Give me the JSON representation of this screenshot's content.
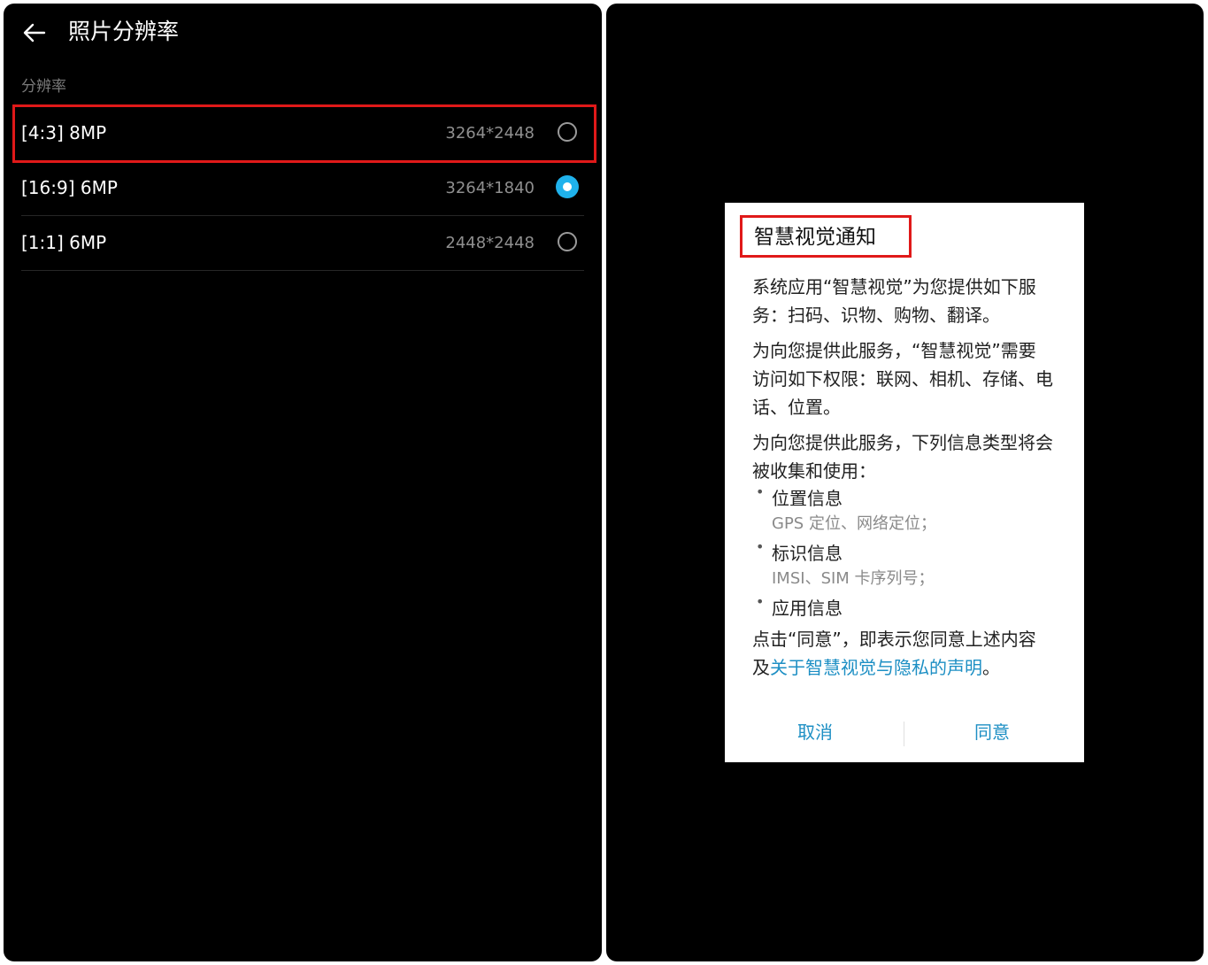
{
  "left_screen": {
    "title": "照片分辨率",
    "section_label": "分辨率",
    "options": [
      {
        "label": "[4:3] 8MP",
        "size": "3264*2448",
        "selected": false,
        "highlighted": true
      },
      {
        "label": "[16:9] 6MP",
        "size": "3264*1840",
        "selected": true,
        "highlighted": false
      },
      {
        "label": "[1:1] 6MP",
        "size": "2448*2448",
        "selected": false,
        "highlighted": false
      }
    ]
  },
  "dialog": {
    "title": "智慧视觉通知",
    "para1": "系统应用“智慧视觉”为您提供如下服务：扫码、识物、购物、翻译。",
    "para2": "为向您提供此服务，“智慧视觉”需要访问如下权限：联网、相机、存储、电话、位置。",
    "para3": "为向您提供此服务，下列信息类型将会被收集和使用：",
    "bullets": [
      {
        "title": "位置信息",
        "detail": "GPS 定位、网络定位；"
      },
      {
        "title": "标识信息",
        "detail": "IMSI、SIM 卡序列号；"
      },
      {
        "title": "应用信息",
        "detail": ""
      }
    ],
    "footer_prefix": "点击“同意”，即表示您同意上述内容及",
    "footer_link": "关于智慧视觉与隐私的声明",
    "footer_suffix": "。",
    "cancel_label": "取消",
    "agree_label": "同意"
  },
  "colors": {
    "accent": "#1fb2ec",
    "link": "#1d8fc4",
    "highlight_box": "#e01919",
    "background": "#000000"
  }
}
